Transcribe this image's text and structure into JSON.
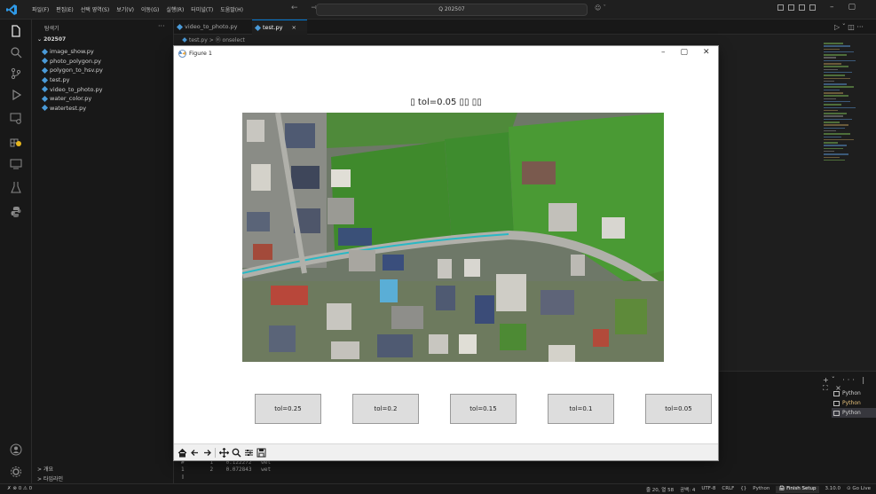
{
  "titlebar": {
    "menu": [
      "파일(F)",
      "편집(E)",
      "선택 영역(S)",
      "보기(V)",
      "이동(G)",
      "실행(R)",
      "터미널(T)",
      "도움말(H)"
    ],
    "nav": "← →",
    "search": "Q 202507",
    "copilot": "☺ ˇ"
  },
  "sidebar": {
    "header": "탐색기",
    "more": "···",
    "folder": "202507",
    "files": [
      "image_show.py",
      "photo_polygon.py",
      "polygon_to_hsv.py",
      "test.py",
      "video_to_photo.py",
      "water_color.py",
      "watertest.py"
    ],
    "outline": "개요",
    "timeline": "타임라인"
  },
  "editor": {
    "tabs": [
      {
        "label": "video_to_photo.py",
        "active": false
      },
      {
        "label": "test.py",
        "active": true
      }
    ],
    "breadcrumb": "test.py > ⓜ onselect",
    "right_controls": "▷ ˇ ◫ ···"
  },
  "figure": {
    "window_title": "Figure 1",
    "plot_title": "▯ tol=0.05 ▯▯ ▯▯",
    "buttons": [
      "tol=0.25",
      "tol=0.2",
      "tol=0.15",
      "tol=0.1",
      "tol=0.05"
    ],
    "toolbar": [
      "home-icon",
      "back-icon",
      "forward-icon",
      "pan-icon",
      "zoom-icon",
      "configure-icon",
      "save-icon"
    ]
  },
  "panel": {
    "terminal_lines": "#        1    0.122272   wet\n1        2    0.072843   wet\n▯",
    "controls": "+ˇ ··· | ⛶ ×",
    "terminals": [
      {
        "label": "Python",
        "selected": false
      },
      {
        "label": "Python",
        "selected": false
      },
      {
        "label": "Python",
        "selected": true
      }
    ]
  },
  "statusbar": {
    "left": "✗  ⊗ 0 ⚠ 0",
    "position": "줄 20, 열 58",
    "spaces": "공백: 4",
    "encoding": "UTF-8",
    "eol": "CRLF",
    "braces": "{}",
    "language": "Python",
    "finish_setup": "🖨 Finish Setup",
    "version": "3.10.0",
    "golive": "⊙ Go Live"
  },
  "colors": {
    "accent": "#0078d4",
    "file_icon": "#4a9ad8",
    "background": "#1e1e1e",
    "figure_bg": "#ffffff",
    "button_bg": "#dddddd"
  }
}
